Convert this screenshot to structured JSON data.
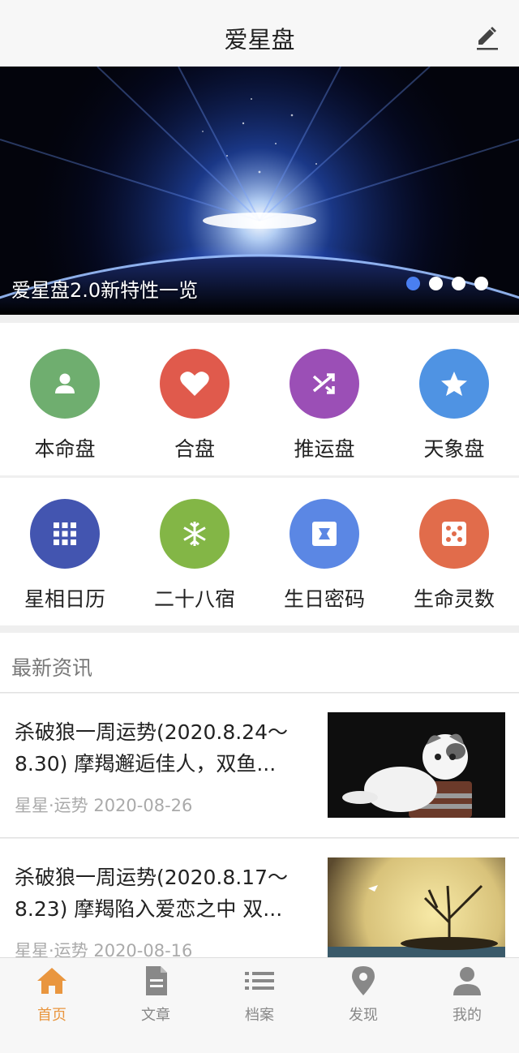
{
  "header": {
    "title": "爱星盘",
    "edit_icon": "pencil-icon"
  },
  "banner": {
    "caption": "爱星盘2.0新特性一览",
    "slides": 4,
    "active_slide": 1,
    "dot_active_color": "#4a7ff0"
  },
  "features_row1": [
    {
      "label": "本命盘",
      "icon": "person-icon",
      "color": "#6fae6f"
    },
    {
      "label": "合盘",
      "icon": "heart-icon",
      "color": "#e05a4c"
    },
    {
      "label": "推运盘",
      "icon": "shuffle-icon",
      "color": "#9b4fb6"
    },
    {
      "label": "天象盘",
      "icon": "star-icon",
      "color": "#4f93e3"
    }
  ],
  "features_row2": [
    {
      "label": "星相日历",
      "icon": "grid-icon",
      "color": "#4355b0"
    },
    {
      "label": "二十八宿",
      "icon": "snowflake-icon",
      "color": "#83b646"
    },
    {
      "label": "生日密码",
      "icon": "puzzle-icon",
      "color": "#5b87e4"
    },
    {
      "label": "生命灵数",
      "icon": "dice-icon",
      "color": "#e16c4b"
    }
  ],
  "news": {
    "heading": "最新资讯",
    "items": [
      {
        "line1": "杀破狼一周运势(2020.8.24～",
        "line2": "8.30) 摩羯邂逅佳人，双鱼...",
        "meta": "星星·运势  2020-08-26"
      },
      {
        "line1": "杀破狼一周运势(2020.8.17～",
        "line2": "8.23) 摩羯陷入爱恋之中 双...",
        "meta": "星星·运势  2020-08-16"
      }
    ]
  },
  "tabbar": {
    "active_color": "#e9963f",
    "tabs": [
      {
        "label": "首页",
        "icon": "home-icon"
      },
      {
        "label": "文章",
        "icon": "document-icon"
      },
      {
        "label": "档案",
        "icon": "list-icon"
      },
      {
        "label": "发现",
        "icon": "location-pin-icon"
      },
      {
        "label": "我的",
        "icon": "user-icon"
      }
    ]
  }
}
